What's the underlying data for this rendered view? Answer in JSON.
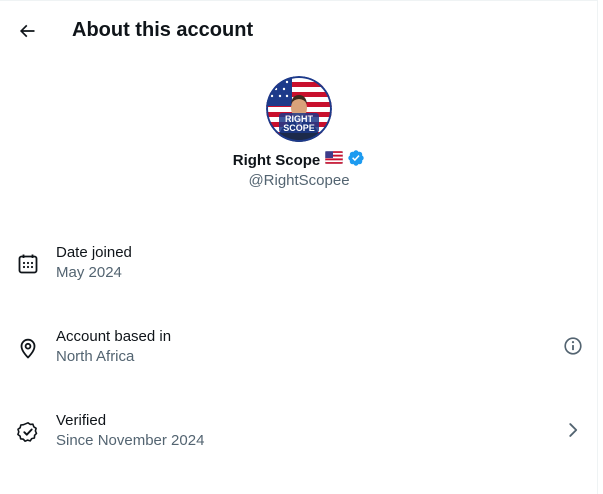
{
  "header": {
    "back_icon": "arrow-left-icon",
    "title": "About this account"
  },
  "profile": {
    "avatar_text_line1": "RIGHT",
    "avatar_text_line2": "SCOPE",
    "display_name": "Right Scope",
    "flag_icon": "us-flag-icon",
    "verified_icon": "verified-badge-icon",
    "handle": "@RightScopee"
  },
  "details": [
    {
      "icon": "calendar-icon",
      "label": "Date joined",
      "value": "May 2024",
      "action_icon": ""
    },
    {
      "icon": "location-pin-icon",
      "label": "Account based in",
      "value": "North Africa",
      "action_icon": "info-icon"
    },
    {
      "icon": "verified-check-icon",
      "label": "Verified",
      "value": "Since November 2024",
      "action_icon": "chevron-right-icon"
    }
  ],
  "colors": {
    "text_primary": "#0f1419",
    "text_secondary": "#536471",
    "verified_blue": "#1d9bf0",
    "border": "#eff3f4"
  }
}
